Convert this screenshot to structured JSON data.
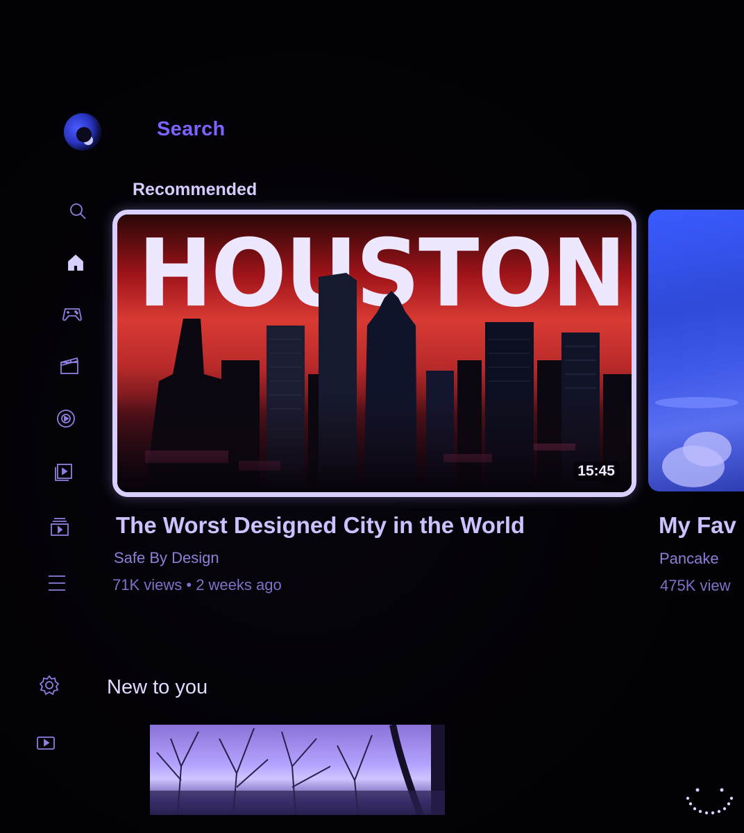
{
  "header": {
    "search_label": "Search"
  },
  "sidebar": {
    "items": [
      {
        "icon": "search-icon"
      },
      {
        "icon": "home-icon"
      },
      {
        "icon": "gaming-icon"
      },
      {
        "icon": "movies-icon"
      },
      {
        "icon": "music-icon"
      },
      {
        "icon": "subscriptions-icon"
      },
      {
        "icon": "library-icon"
      },
      {
        "icon": "menu-icon"
      },
      {
        "icon": "settings-icon"
      },
      {
        "icon": "youtube-icon"
      }
    ]
  },
  "sections": {
    "recommended": "Recommended",
    "new_to_you": "New to you"
  },
  "videos": [
    {
      "thumbnail_text": "HOUSTON",
      "duration": "15:45",
      "title": "The Worst Designed City in the World",
      "channel": "Safe By Design",
      "meta": "71K views • 2 weeks ago"
    },
    {
      "title": "My Fav",
      "channel": "Pancake",
      "meta": "475K view"
    }
  ],
  "colors": {
    "accent": "#7c63ff",
    "focus_border": "#d9d0ff",
    "text_primary": "#ccc2ff",
    "text_secondary": "#8d80d8"
  }
}
